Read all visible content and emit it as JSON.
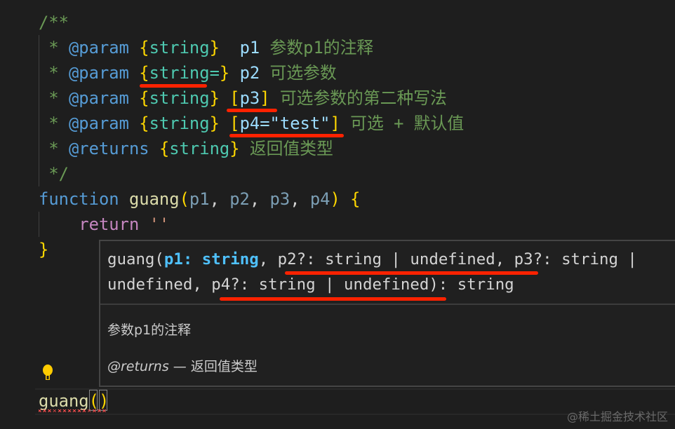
{
  "code_lines": [
    [
      [
        "/**",
        "c-comment"
      ]
    ],
    [
      [
        " * ",
        "c-comment"
      ],
      [
        "@param",
        "c-tag"
      ],
      [
        " ",
        "c-punc"
      ],
      [
        "{",
        "c-brace"
      ],
      [
        "string",
        "c-type"
      ],
      [
        "}",
        "c-brace"
      ],
      [
        "  ",
        "c-punc"
      ],
      [
        "p1",
        "c-param"
      ],
      [
        " 参数p1的注释",
        "c-comment"
      ]
    ],
    [
      [
        " * ",
        "c-comment"
      ],
      [
        "@param",
        "c-tag"
      ],
      [
        " ",
        "c-punc"
      ],
      [
        "{",
        "c-brace"
      ],
      [
        "string=",
        "c-type"
      ],
      [
        "}",
        "c-brace"
      ],
      [
        " ",
        "c-punc"
      ],
      [
        "p2",
        "c-param"
      ],
      [
        " 可选参数",
        "c-comment"
      ]
    ],
    [
      [
        " * ",
        "c-comment"
      ],
      [
        "@param",
        "c-tag"
      ],
      [
        " ",
        "c-punc"
      ],
      [
        "{",
        "c-brace"
      ],
      [
        "string",
        "c-type"
      ],
      [
        "}",
        "c-brace"
      ],
      [
        " ",
        "c-punc"
      ],
      [
        "[",
        "c-brace"
      ],
      [
        "p3",
        "c-param"
      ],
      [
        "]",
        "c-brace"
      ],
      [
        " 可选参数的第二种写法",
        "c-comment"
      ]
    ],
    [
      [
        " * ",
        "c-comment"
      ],
      [
        "@param",
        "c-tag"
      ],
      [
        " ",
        "c-punc"
      ],
      [
        "{",
        "c-brace"
      ],
      [
        "string",
        "c-type"
      ],
      [
        "}",
        "c-brace"
      ],
      [
        " ",
        "c-punc"
      ],
      [
        "[",
        "c-brace"
      ],
      [
        "p4=\"test\"",
        "c-param"
      ],
      [
        "]",
        "c-brace"
      ],
      [
        " 可选 + 默认值",
        "c-comment"
      ]
    ],
    [
      [
        " * ",
        "c-comment"
      ],
      [
        "@returns",
        "c-tag"
      ],
      [
        " ",
        "c-punc"
      ],
      [
        "{",
        "c-brace"
      ],
      [
        "string",
        "c-type"
      ],
      [
        "}",
        "c-brace"
      ],
      [
        " 返回值类型",
        "c-comment"
      ]
    ],
    [
      [
        " */",
        "c-comment"
      ]
    ],
    [
      [
        "function",
        "c-kw"
      ],
      [
        " ",
        "c-punc"
      ],
      [
        "guang",
        "c-fn"
      ],
      [
        "(",
        "c-brace"
      ],
      [
        "p1",
        "c-dim"
      ],
      [
        ", ",
        "c-punc"
      ],
      [
        "p2",
        "c-dim"
      ],
      [
        ", ",
        "c-punc"
      ],
      [
        "p3",
        "c-dim"
      ],
      [
        ", ",
        "c-punc"
      ],
      [
        "p4",
        "c-dim"
      ],
      [
        ")",
        "c-brace"
      ],
      [
        " ",
        "c-punc"
      ],
      [
        "{",
        "c-brace"
      ]
    ],
    [
      [
        "    ",
        "c-punc"
      ],
      [
        "return",
        "c-ret"
      ],
      [
        " ",
        "c-punc"
      ],
      [
        "''",
        "c-str"
      ]
    ],
    [
      [
        "}",
        "c-brace"
      ]
    ]
  ],
  "current_line": [
    [
      "guang",
      "c-fn"
    ],
    [
      "(",
      "c-brace"
    ],
    [
      ")",
      "c-brace"
    ]
  ],
  "hover": {
    "sig_prefix": "guang(",
    "sig_p1": "p1: string",
    "sig_line1_rest": ", p2?: string | undefined, p3?: string |",
    "sig_line2": "undefined, p4?: string | undefined): string",
    "param_doc": "参数p1的注释",
    "returns_tag": "@returns",
    "returns_sep": " — ",
    "returns_doc": "返回值类型"
  },
  "watermark": "@稀土掘金技术社区",
  "colors": {
    "annotation": "#ff2200",
    "bulb": "#ffcc00"
  }
}
